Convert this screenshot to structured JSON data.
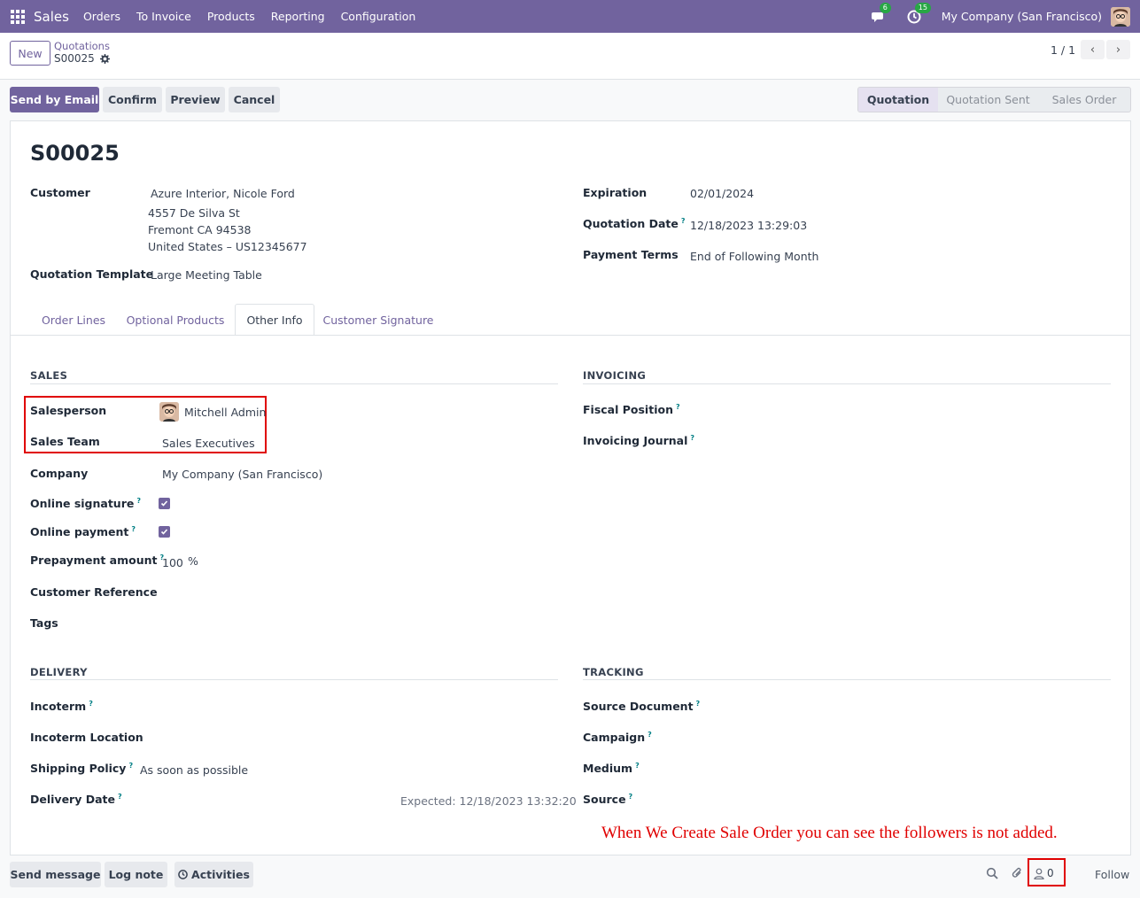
{
  "navbar": {
    "app_name": "Sales",
    "menu": [
      "Orders",
      "To Invoice",
      "Products",
      "Reporting",
      "Configuration"
    ],
    "messages_count": "6",
    "activities_count": "15",
    "company": "My Company (San Francisco)"
  },
  "control_panel": {
    "new_label": "New",
    "breadcrumb_parent": "Quotations",
    "breadcrumb_current": "S00025",
    "pager": "1 / 1"
  },
  "actions": {
    "send_by_email": "Send by Email",
    "confirm": "Confirm",
    "preview": "Preview",
    "cancel": "Cancel"
  },
  "statusbar": {
    "stages": [
      "Quotation",
      "Quotation Sent",
      "Sales Order"
    ],
    "active": "Quotation"
  },
  "form": {
    "title": "S00025",
    "customer_label": "Customer",
    "customer_name": "Azure Interior, Nicole Ford",
    "customer_address": [
      "4557 De Silva St",
      "Fremont CA 94538",
      "United States – US12345677"
    ],
    "template_label": "Quotation Template",
    "template_value": "Large Meeting Table",
    "expiration_label": "Expiration",
    "expiration_value": "02/01/2024",
    "quotation_date_label": "Quotation Date",
    "quotation_date_value": "12/18/2023 13:29:03",
    "payment_terms_label": "Payment Terms",
    "payment_terms_value": "End of Following Month"
  },
  "tabs": [
    "Order Lines",
    "Optional Products",
    "Other Info",
    "Customer Signature"
  ],
  "active_tab": "Other Info",
  "sales": {
    "heading": "SALES",
    "salesperson_label": "Salesperson",
    "salesperson_value": "Mitchell Admin",
    "sales_team_label": "Sales Team",
    "sales_team_value": "Sales Executives",
    "company_label": "Company",
    "company_value": "My Company (San Francisco)",
    "online_signature_label": "Online signature",
    "online_signature_checked": true,
    "online_payment_label": "Online payment",
    "online_payment_checked": true,
    "prepayment_label": "Prepayment amount",
    "prepayment_value": "100",
    "prepayment_unit": "%",
    "customer_reference_label": "Customer Reference",
    "tags_label": "Tags"
  },
  "invoicing": {
    "heading": "INVOICING",
    "fiscal_position_label": "Fiscal Position",
    "invoicing_journal_label": "Invoicing Journal"
  },
  "delivery": {
    "heading": "DELIVERY",
    "incoterm_label": "Incoterm",
    "incoterm_location_label": "Incoterm Location",
    "shipping_policy_label": "Shipping Policy",
    "shipping_policy_value": "As soon as possible",
    "delivery_date_label": "Delivery Date",
    "expected_value": "Expected: 12/18/2023 13:32:20"
  },
  "tracking": {
    "heading": "TRACKING",
    "source_document_label": "Source Document",
    "campaign_label": "Campaign",
    "medium_label": "Medium",
    "source_label": "Source"
  },
  "help_mark": "?",
  "annotation": "When We Create Sale Order you can see the followers is not added.",
  "chatter": {
    "send_message": "Send message",
    "log_note": "Log note",
    "activities": "Activities",
    "followers_count": "0",
    "follow": "Follow"
  },
  "colors": {
    "brand": "#71639e",
    "annotation_red": "#e00000"
  }
}
